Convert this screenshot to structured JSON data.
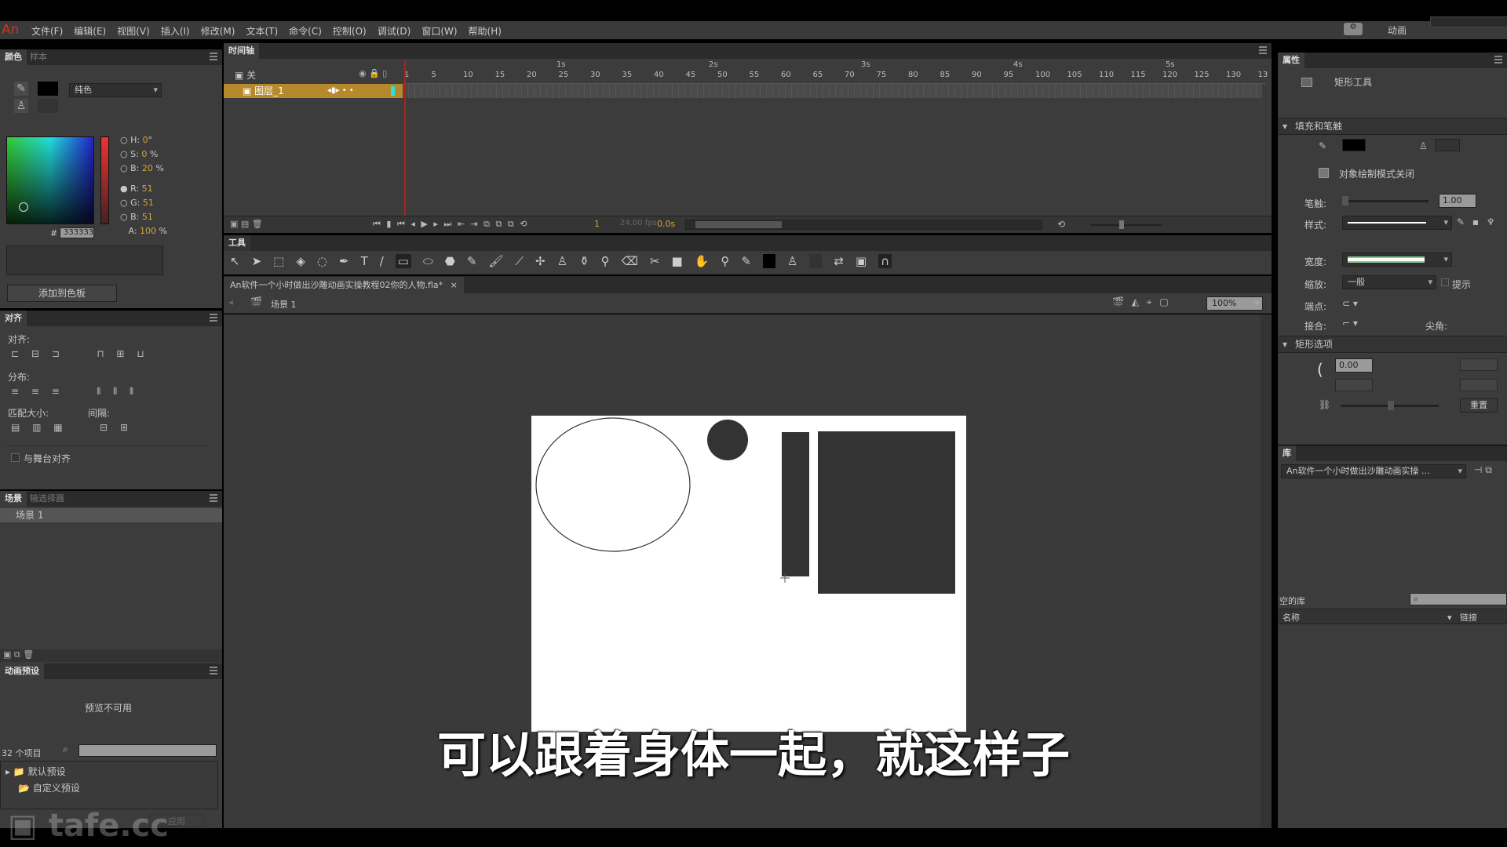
{
  "app": {
    "logo": "An",
    "workspace": "动画",
    "sync_icon": "sync-settings-icon"
  },
  "menu": [
    "文件(F)",
    "编辑(E)",
    "视图(V)",
    "插入(I)",
    "修改(M)",
    "文本(T)",
    "命令(C)",
    "控制(O)",
    "调试(D)",
    "窗口(W)",
    "帮助(H)"
  ],
  "color_panel": {
    "tabs": [
      "颜色",
      "样本"
    ],
    "fill_type": "纯色",
    "H": "0",
    "H_unit": "°",
    "S": "0",
    "S_unit": "%",
    "B": "20",
    "B_unit": "%",
    "R": "51",
    "G": "51",
    "Bv": "51",
    "A": "100",
    "A_unit": "%",
    "hex": "333333",
    "add_button": "添加到色板",
    "labels": {
      "H": "H:",
      "S": "S:",
      "B": "B:",
      "R": "R:",
      "G": "G:",
      "Bb": "B:",
      "A": "A:",
      "hash": "#"
    }
  },
  "align_panel": {
    "tab": "对齐",
    "align": "对齐:",
    "distribute": "分布:",
    "match": "匹配大小:",
    "space": "间隔:",
    "to_stage": "与舞台对齐"
  },
  "scene_panel": {
    "tabs": [
      "场景",
      "输选择器"
    ],
    "scene": "场景 1"
  },
  "motion_presets": {
    "tab": "动画预设",
    "preview": "预览不可用",
    "count": "32 个项目",
    "folders": [
      "默认预设",
      "自定义预设"
    ],
    "apply": "应用"
  },
  "timeline": {
    "tab": "时间轴",
    "header_label": "关",
    "layer": "图层_1",
    "seconds": [
      "1s",
      "2s",
      "3s",
      "4s",
      "5s"
    ],
    "frames": [
      "1",
      "5",
      "10",
      "15",
      "20",
      "25",
      "30",
      "35",
      "40",
      "45",
      "50",
      "55",
      "60",
      "65",
      "70",
      "75",
      "80",
      "85",
      "90",
      "95",
      "100",
      "105",
      "110",
      "115",
      "120",
      "125",
      "130",
      "13"
    ],
    "current_frame": "1",
    "fps": "24.00 fps",
    "time": "0.0s"
  },
  "tools": {
    "tab": "工具"
  },
  "document": {
    "tab": "An软件一个小时做出沙雕动画实操教程02你的人物.fla*",
    "close": "×",
    "scene": "场景 1",
    "zoom": "100%"
  },
  "properties": {
    "tab": "属性",
    "tool": "矩形工具",
    "fill_stroke": "填充和笔触",
    "object_mode": "对象绘制模式关闭",
    "stroke_label": "笔触:",
    "stroke_value": "1.00",
    "style_label": "样式:",
    "width_label": "宽度:",
    "scale_label": "缩放:",
    "scale_value": "一般",
    "hint": "提示",
    "cap_label": "端点:",
    "join_label": "接合:",
    "miter_label": "尖角:",
    "rect_options": "矩形选项",
    "corner_tl": "0.00",
    "reset": "重置",
    "stroke_color": "#000000",
    "fill_color": "#333333"
  },
  "library": {
    "tab": "库",
    "doc": "An软件一个小时做出沙雕动画实操 ...",
    "empty": "空的库",
    "col_name": "名称",
    "col_link": "链接"
  },
  "subtitle": "可以跟着身体一起，就这样子",
  "watermark": "tafe.cc"
}
